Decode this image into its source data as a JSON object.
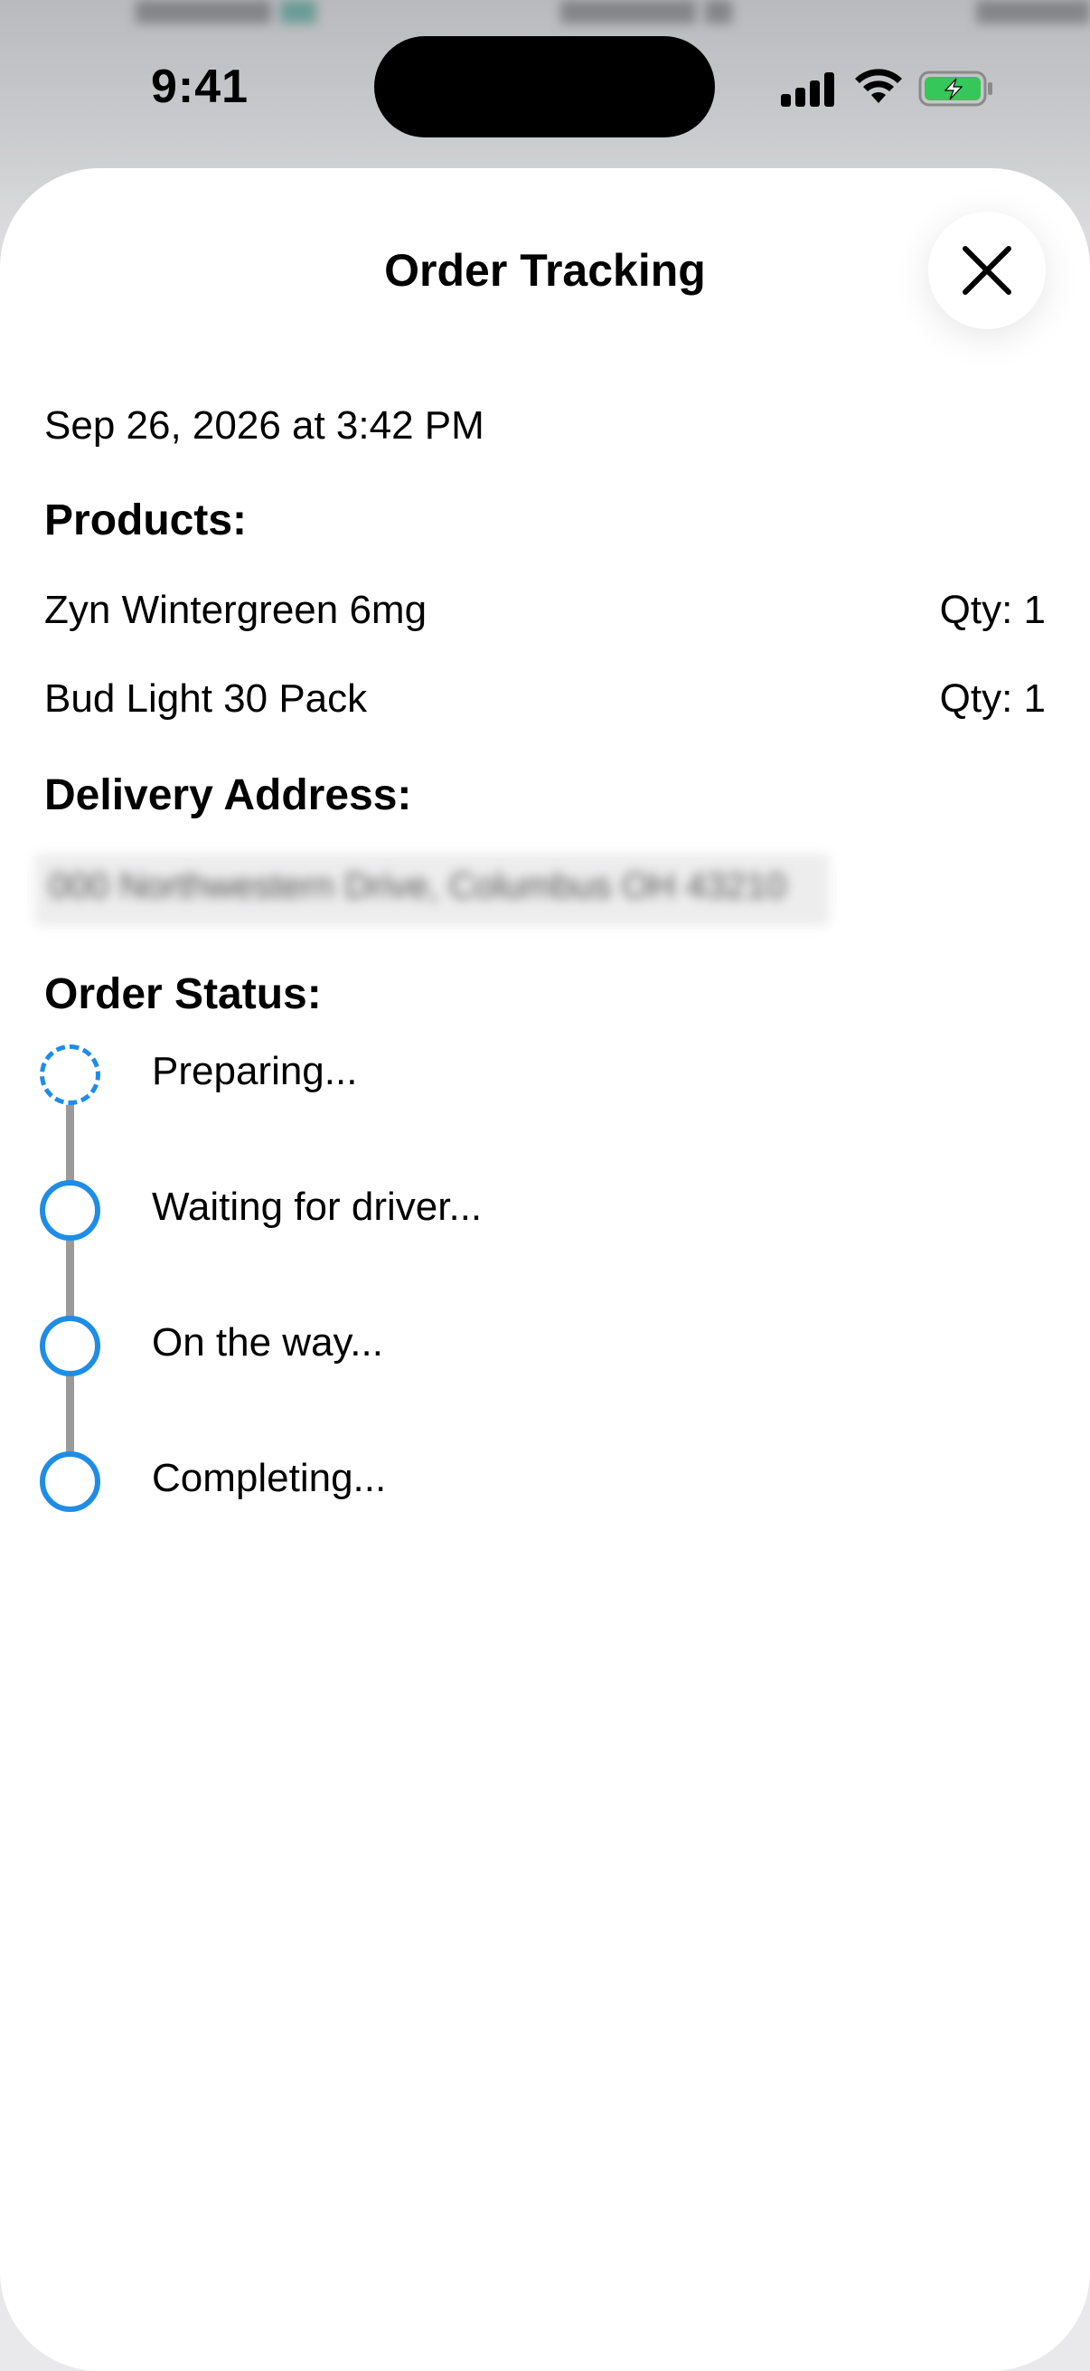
{
  "status_bar": {
    "time": "9:41"
  },
  "sheet": {
    "title": "Order Tracking",
    "close_icon": "close-icon"
  },
  "order": {
    "date": "Sep 26, 2026 at 3:42 PM",
    "products_label": "Products:",
    "products": [
      {
        "name": "Zyn Wintergreen 6mg",
        "qty": "Qty: 1"
      },
      {
        "name": "Bud Light 30 Pack",
        "qty": "Qty: 1"
      }
    ],
    "address_label": "Delivery Address:",
    "address_value": "000 Northwestern Drive, Columbus OH 43210",
    "status_label": "Order Status:",
    "steps": [
      {
        "label": "Preparing...",
        "state": "in-progress"
      },
      {
        "label": "Waiting for driver...",
        "state": "pending"
      },
      {
        "label": "On the way...",
        "state": "pending"
      },
      {
        "label": "Completing...",
        "state": "pending"
      }
    ]
  },
  "colors": {
    "accent": "#1f8ce6",
    "timeline_line": "#9a9a9a",
    "battery_fill": "#34c759"
  }
}
